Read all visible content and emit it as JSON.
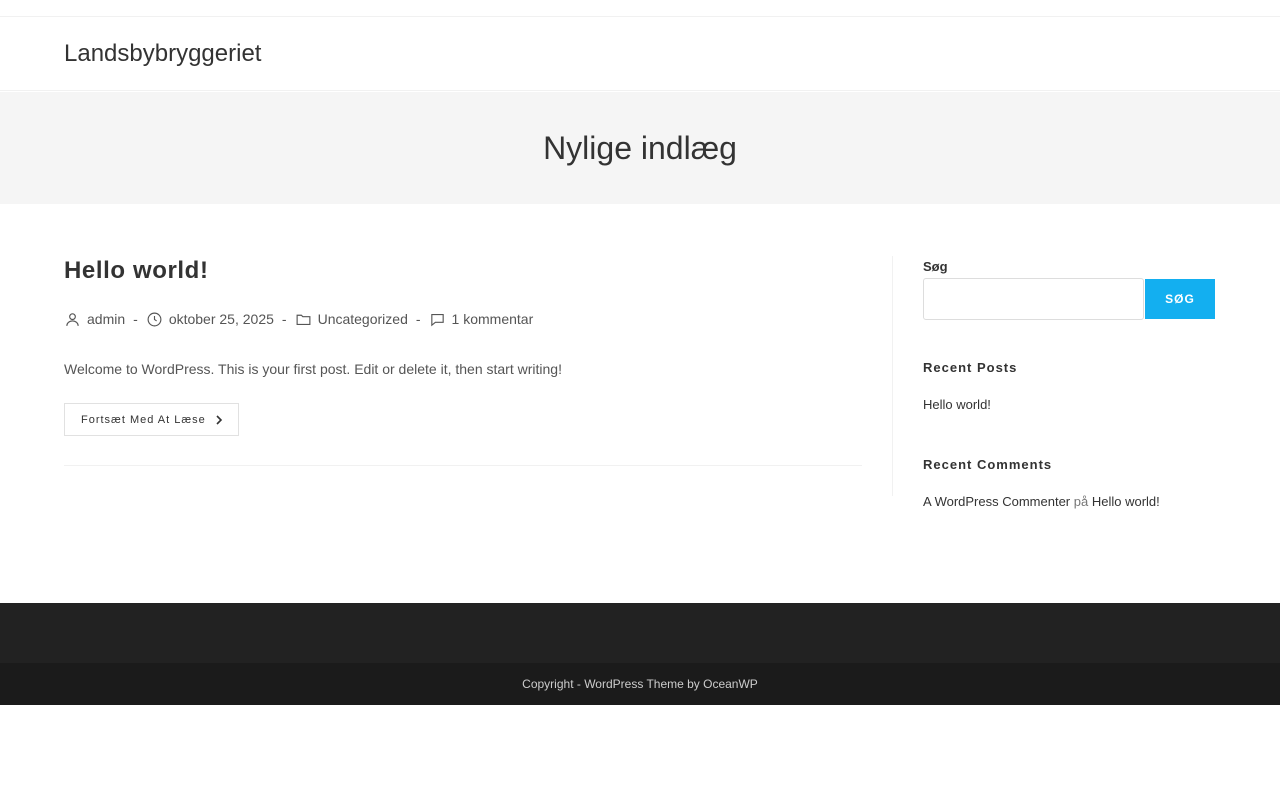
{
  "site": {
    "title": "Landsbybryggeriet"
  },
  "page": {
    "title": "Nylige indlæg"
  },
  "post": {
    "title": "Hello world!",
    "author": "admin",
    "date": "oktober 25, 2025",
    "category": "Uncategorized",
    "comments": "1 kommentar",
    "separator": "-",
    "excerpt": "Welcome to WordPress. This is your first post. Edit or delete it, then start writing!",
    "read_more": "Fortsæt Med At Læse"
  },
  "sidebar": {
    "search_label": "Søg",
    "search_value": "",
    "search_button": "SØG",
    "recent_posts_title": "Recent Posts",
    "recent_posts": [
      "Hello world!"
    ],
    "recent_comments_title": "Recent Comments",
    "recent_comment": {
      "author": "A WordPress Commenter",
      "on": "på",
      "post": "Hello world!"
    }
  },
  "footer": {
    "copyright": "Copyright - WordPress Theme by OceanWP"
  },
  "colors": {
    "accent": "#13aff0",
    "footer_bg": "#222222",
    "footer_bottom_bg": "#1b1b1b",
    "page_header_bg": "#f5f5f5"
  }
}
